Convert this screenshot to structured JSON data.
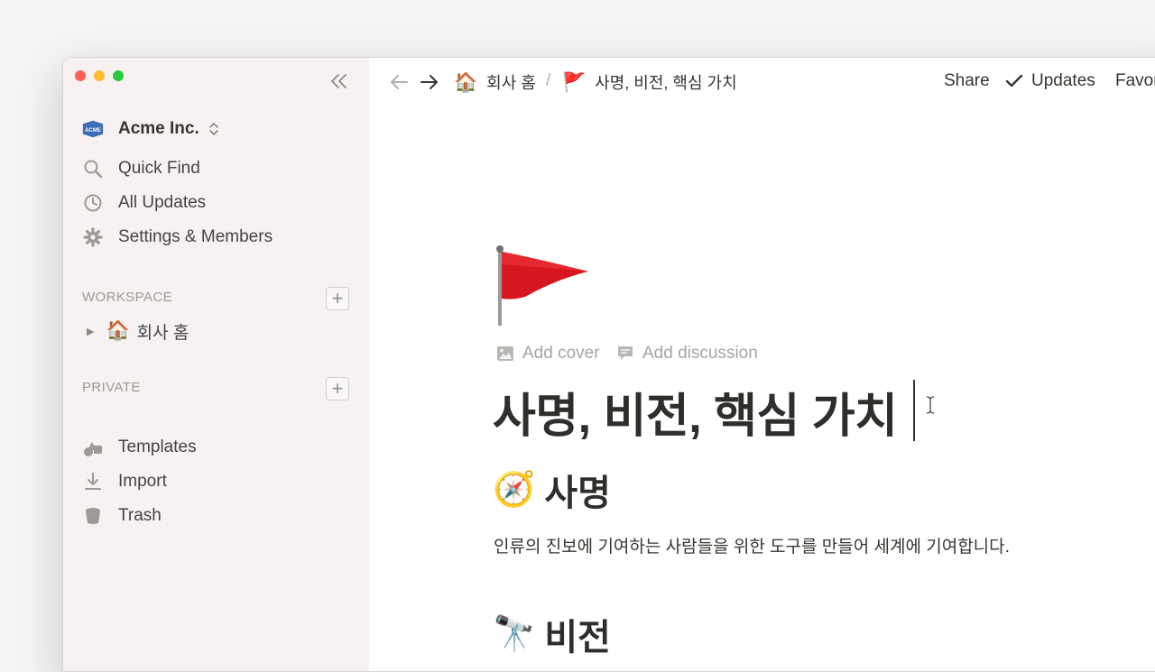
{
  "colors": {
    "close": "#ff5f57",
    "minimize": "#febc2e",
    "zoom": "#28c840",
    "sidebar_bg": "#f7f1f1",
    "acme_logo": "#3d6cb4",
    "flag_red": "#d7171f"
  },
  "sidebar": {
    "workspace_name": "Acme Inc.",
    "logo_text": "ACME",
    "quick_find": "Quick Find",
    "all_updates": "All Updates",
    "settings_members": "Settings & Members",
    "workspace_section": "WORKSPACE",
    "workspace_page": {
      "emoji": "🏠",
      "label": "회사 홈"
    },
    "private_section": "PRIVATE",
    "templates": "Templates",
    "import": "Import",
    "trash": "Trash"
  },
  "topbar": {
    "breadcrumb": [
      {
        "emoji": "🏠",
        "label": "회사 홈"
      },
      {
        "emoji": "🚩",
        "label": "사명, 비전, 핵심 가치"
      }
    ],
    "separator": "/",
    "share": "Share",
    "updates": "Updates",
    "favorite": "Favorite"
  },
  "page": {
    "add_cover": "Add cover",
    "add_discussion": "Add discussion",
    "title": "사명, 비전, 핵심 가치",
    "sections": [
      {
        "emoji": "🧭",
        "heading": "사명",
        "text": "인류의 진보에 기여하는 사람들을 위한 도구를 만들어 세계에 기여합니다."
      },
      {
        "emoji": "🔭",
        "heading": "비전"
      }
    ]
  }
}
